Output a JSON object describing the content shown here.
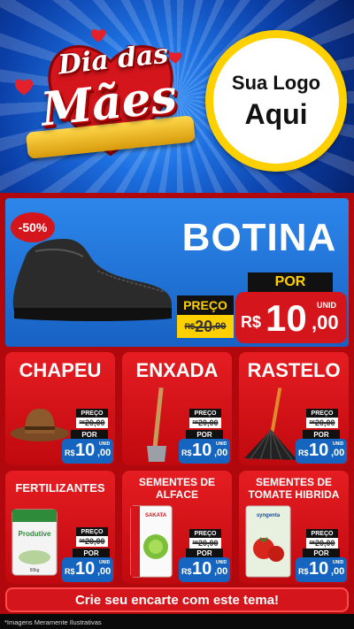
{
  "header": {
    "title_line1": "Dia das",
    "title_line2": "Mães",
    "logo_line1": "Sua Logo",
    "logo_line2": "Aqui"
  },
  "featured": {
    "discount": "-50%",
    "name": "BOTINA",
    "old_label": "PREÇO",
    "old_int": "20",
    "old_dec": ",00",
    "old_cur": "R$",
    "new_label": "POR",
    "currency": "R$",
    "new_int": "10",
    "new_dec": ",00",
    "unit": "UNID",
    "image_icon": "boot-icon"
  },
  "products": [
    {
      "name": "CHAPEU",
      "icon": "hat-icon",
      "old_label": "PREÇO",
      "old_cur": "R$",
      "old_price": "20,00",
      "new_label": "POR",
      "currency": "R$",
      "int": "10",
      "dec": ",00",
      "unit": "UNID"
    },
    {
      "name": "ENXADA",
      "icon": "hoe-icon",
      "old_label": "PREÇO",
      "old_cur": "R$",
      "old_price": "20,00",
      "new_label": "POR",
      "currency": "R$",
      "int": "10",
      "dec": ",00",
      "unit": "UNID"
    },
    {
      "name": "RASTELO",
      "icon": "rake-icon",
      "old_label": "PREÇO",
      "old_cur": "R$",
      "old_price": "20,00",
      "new_label": "POR",
      "currency": "R$",
      "int": "10",
      "dec": ",00",
      "unit": "UNID"
    },
    {
      "name": "FERTILIZANTES",
      "icon": "fertilizer-bag-icon",
      "bag_label": "Produtive",
      "bag_weight": "50kg",
      "old_label": "PREÇO",
      "old_cur": "R$",
      "old_price": "20,00",
      "new_label": "POR",
      "currency": "R$",
      "int": "10",
      "dec": ",00",
      "unit": "UNID"
    },
    {
      "name": "SEMENTES DE ALFACE",
      "name_l1": "SEMENTES DE",
      "name_l2": "ALFACE",
      "icon": "lettuce-seeds-icon",
      "pack_label": "SAKATA",
      "old_label": "PREÇO",
      "old_cur": "R$",
      "old_price": "20,00",
      "new_label": "POR",
      "currency": "R$",
      "int": "10",
      "dec": ",00",
      "unit": "UNID"
    },
    {
      "name": "SEMENTES DE TOMATE HIBRIDA",
      "name_l1": "SEMENTES DE",
      "name_l2": "TOMATE HIBRIDA",
      "icon": "tomato-seeds-icon",
      "pack_label": "syngenta",
      "old_label": "PREÇO",
      "old_cur": "R$",
      "old_price": "20,00",
      "new_label": "POR",
      "currency": "R$",
      "int": "10",
      "dec": ",00",
      "unit": "UNID"
    }
  ],
  "footer": {
    "cta": "Crie seu encarte com este tema!",
    "note": "*Imagens Meramente Ilustrativas"
  },
  "colors": {
    "red": "#d4151b",
    "blue": "#1565c0",
    "yellow": "#ffd000",
    "header_blue": "#1d6fe0"
  }
}
